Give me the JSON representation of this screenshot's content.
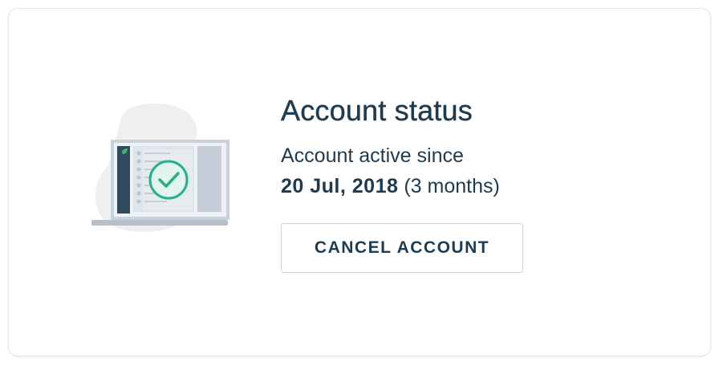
{
  "card": {
    "title": "Account status",
    "since_label": "Account active since",
    "since_date": "20 Jul, 2018",
    "duration": "(3 months)",
    "cancel_button_label": "CANCEL ACCOUNT"
  },
  "illustration": {
    "icon": "laptop-check-icon",
    "colors": {
      "blob": "#efefef",
      "screen_frame": "#c9d2dc",
      "screen": "#ffffff",
      "sidebar": "#2f4a5d",
      "leaf": "#3fb16f",
      "check": "#26b08a",
      "base": "#b5c0c9"
    }
  },
  "colors": {
    "text_primary": "#1d3b51",
    "border": "#cfd3d8",
    "background": "#ffffff"
  }
}
